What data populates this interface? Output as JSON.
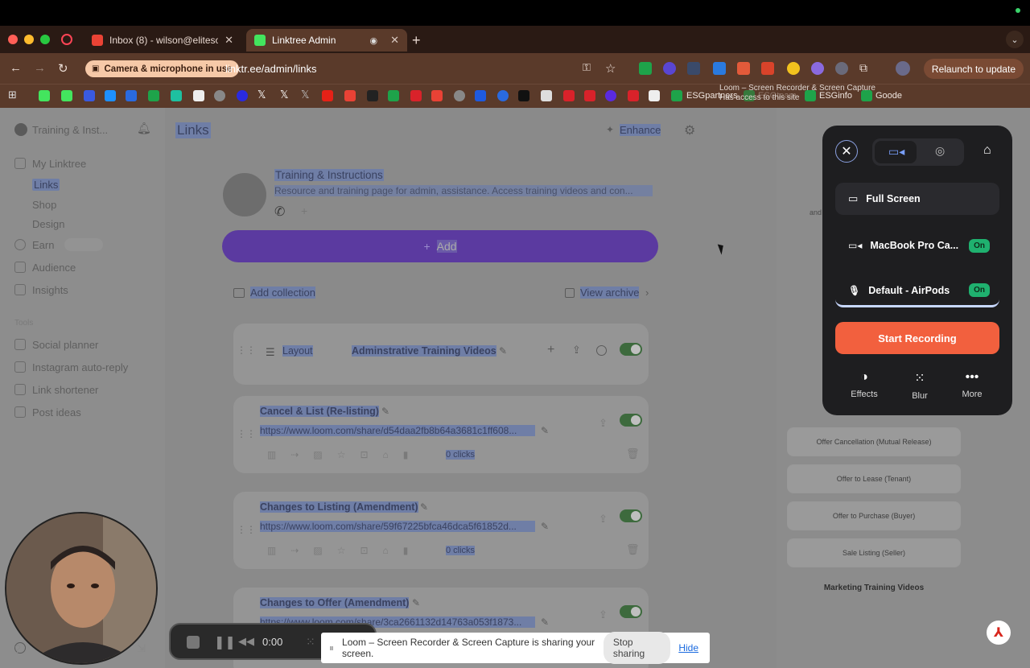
{
  "browser": {
    "tabs": [
      {
        "label": "Inbox (8) - wilson@elitesold.c",
        "fav_color": "#ea4335"
      },
      {
        "label": "Linktree Admin",
        "fav_color": "#43e55e"
      }
    ],
    "camera_pill": "Camera & microphone in use",
    "url": "linktr.ee/admin/links",
    "relaunch": "Relaunch to update",
    "bookmarks": [
      "ESGpartners",
      "ESGinfo",
      "Goode"
    ],
    "bookmark_partial": "ESGteam",
    "ext_tooltip_title": "Loom – Screen Recorder & Screen Capture",
    "ext_tooltip_sub": "Has access to this site"
  },
  "sidebar": {
    "workspace": "Training & Inst...",
    "my_linktree": "My Linktree",
    "links": "Links",
    "shop": "Shop",
    "design": "Design",
    "earn": "Earn",
    "audience": "Audience",
    "insights": "Insights",
    "tools_label": "Tools",
    "social_planner": "Social planner",
    "instagram": "Instagram auto-reply",
    "shortener": "Link shortener",
    "post_ideas": "Post ideas"
  },
  "header": {
    "title": "Links",
    "enhance": "Enhance"
  },
  "profile": {
    "name": "Training & Instructions",
    "bio": "Resource and training page for admin, assistance. Access training videos and con..."
  },
  "actions": {
    "add": "Add",
    "add_collection": "Add collection",
    "view_archive": "View archive"
  },
  "layout_card": {
    "label": "Layout",
    "title": "Adminstrative Training Videos"
  },
  "links": [
    {
      "title": "Cancel & List (Re-listing)",
      "url": "https://www.loom.com/share/d54daa2fb8b64a3681c1ff608...",
      "clicks": "0 clicks"
    },
    {
      "title": "Changes to Listing (Amendment)",
      "url": "https://www.loom.com/share/59f67225bfca46dca5f61852d...",
      "clicks": "0 clicks"
    },
    {
      "title": "Changes to Offer (Amendment)",
      "url": "https://www.loom.com/share/3ca2661132d14763a053f1873..."
    }
  ],
  "preview": {
    "buttons": [
      "Offer Cancellation (Mutual Release)",
      "Offer to Lease (Tenant)",
      "Offer to Purchase (Buyer)",
      "Sale Listing (Seller)"
    ],
    "section": "Marketing Training Videos",
    "partial": "and"
  },
  "loom": {
    "full_screen": "Full Screen",
    "camera": "MacBook Pro Ca...",
    "mic": "Default - AirPods",
    "on": "On",
    "start": "Start Recording",
    "effects": "Effects",
    "blur": "Blur",
    "more": "More"
  },
  "recording": {
    "time": "0:00"
  },
  "share": {
    "message": "Loom – Screen Recorder & Screen Capture is sharing your screen.",
    "stop": "Stop sharing",
    "hide": "Hide"
  }
}
